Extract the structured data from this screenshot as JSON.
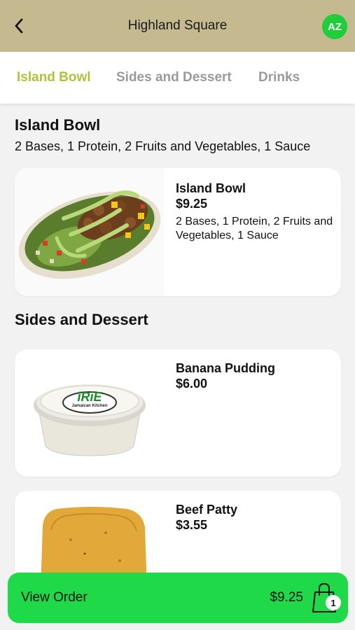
{
  "header": {
    "title": "Highland Square",
    "avatar_initials": "AZ"
  },
  "tabs": [
    {
      "label": "Island Bowl",
      "active": true
    },
    {
      "label": "Sides and Dessert",
      "active": false
    },
    {
      "label": "Drinks",
      "active": false
    }
  ],
  "sections": [
    {
      "title": "Island Bowl",
      "subtitle": "2 Bases, 1 Protein, 2 Fruits and Vegetables, 1 Sauce",
      "items": [
        {
          "name": "Island Bowl",
          "price": "$9.25",
          "description": "2 Bases, 1 Protein, 2 Fruits and Vegetables, 1 Sauce",
          "image": "island-bowl-image"
        }
      ]
    },
    {
      "title": "Sides and Dessert",
      "items": [
        {
          "name": "Banana Pudding",
          "price": "$6.00",
          "image": "banana-pudding-image",
          "label_brand": "iRiE",
          "label_sub": "Jamaican Kitchen"
        },
        {
          "name": "Beef Patty",
          "price": "$3.55",
          "image": "beef-patty-image"
        }
      ]
    }
  ],
  "order_bar": {
    "label": "View Order",
    "total": "$9.25",
    "count": "1",
    "icon": "shopping-bag-icon"
  },
  "colors": {
    "header_bg": "#c5b98f",
    "accent_tab": "#b0c23a",
    "avatar": "#1fce3a",
    "order_bar": "#1fd948"
  }
}
